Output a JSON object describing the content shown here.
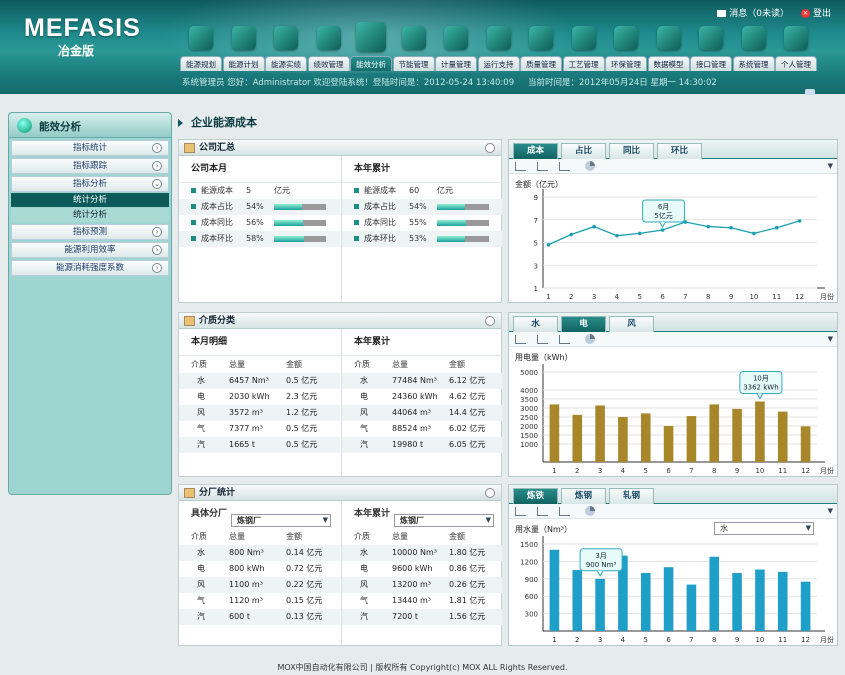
{
  "header": {
    "logo": "MEFASIS",
    "logo_sub": "冶金版",
    "messages": "消息（0未读）",
    "logout": "登出"
  },
  "nav": [
    "能源规划",
    "能源计划",
    "能源实绩",
    "绩效管理",
    "能效分析",
    "节能管理",
    "计量管理",
    "运行支持",
    "质量管理",
    "工艺管理",
    "环保管理",
    "数据模型",
    "接口管理",
    "系统管理",
    "个人管理"
  ],
  "status": {
    "user": "系统管理员    您好：Administrator 欢迎登陆系统！登陆时间是：2012-05-24 13:40:09",
    "time": "当前时间是：2012年05月24日 星期一   14:30:02"
  },
  "sidebar": {
    "title": "能效分析",
    "items": [
      {
        "label": "指标统计",
        "ch": "›"
      },
      {
        "label": "指标跟踪",
        "ch": "›"
      },
      {
        "label": "指标分析",
        "ch": "⌄"
      }
    ],
    "subs": [
      "统计分析",
      "统计分析"
    ],
    "items2": [
      {
        "label": "指标预测",
        "ch": "›"
      },
      {
        "label": "能源利用效率",
        "ch": "›"
      },
      {
        "label": "能源消耗强度系数",
        "ch": "›"
      }
    ]
  },
  "crumb": "企业能源成本",
  "p1": {
    "title": "公司汇总",
    "left_head": "公司本月",
    "right_head": "本年累计",
    "left": [
      {
        "k": "能源成本",
        "v": "5",
        "u": "亿元",
        "bar": null
      },
      {
        "k": "成本占比",
        "v": "54%",
        "bar": 0.54
      },
      {
        "k": "成本同比",
        "v": "56%",
        "bar": 0.56
      },
      {
        "k": "成本环比",
        "v": "58%",
        "bar": 0.58
      }
    ],
    "right": [
      {
        "k": "能源成本",
        "v": "60",
        "u": "亿元",
        "bar": null
      },
      {
        "k": "成本占比",
        "v": "54%",
        "bar": 0.54
      },
      {
        "k": "成本同比",
        "v": "55%",
        "bar": 0.55
      },
      {
        "k": "成本环比",
        "v": "53%",
        "bar": 0.53
      }
    ]
  },
  "p2": {
    "title": "介质分类",
    "left_head": "本月明细",
    "right_head": "本年累计",
    "cols": [
      "介质",
      "总量",
      "金额"
    ],
    "left": [
      [
        "水",
        "6457 Nm³",
        "0.5 亿元"
      ],
      [
        "电",
        "2030 kWh",
        "2.3 亿元"
      ],
      [
        "风",
        "3572 m³",
        "1.2 亿元"
      ],
      [
        "气",
        "7377 m³",
        "0.5 亿元"
      ],
      [
        "汽",
        "1665 t",
        "0.5 亿元"
      ]
    ],
    "right": [
      [
        "水",
        "77484 Nm³",
        "6.12 亿元"
      ],
      [
        "电",
        "24360 kWh",
        "4.62 亿元"
      ],
      [
        "风",
        "44064 m³",
        "14.4 亿元"
      ],
      [
        "气",
        "88524 m³",
        "6.02 亿元"
      ],
      [
        "汽",
        "19980 t",
        "6.05 亿元"
      ]
    ]
  },
  "p3": {
    "title": "分厂统计",
    "left_label": "具体分厂",
    "left_sel": "炼钢厂",
    "right_label": "本年累计",
    "right_sel": "炼钢厂",
    "cols": [
      "介质",
      "总量",
      "金额"
    ],
    "left": [
      [
        "水",
        "800 Nm³",
        "0.14 亿元"
      ],
      [
        "电",
        "800 kWh",
        "0.72 亿元"
      ],
      [
        "风",
        "1100 m³",
        "0.22 亿元"
      ],
      [
        "气",
        "1120 m³",
        "0.15 亿元"
      ],
      [
        "汽",
        "600 t",
        "0.13 亿元"
      ]
    ],
    "right": [
      [
        "水",
        "10000 Nm³",
        "1.80 亿元"
      ],
      [
        "电",
        "9600 kWh",
        "0.86 亿元"
      ],
      [
        "风",
        "13200 m³",
        "0.26 亿元"
      ],
      [
        "气",
        "13440 m³",
        "1.81 亿元"
      ],
      [
        "汽",
        "7200 t",
        "1.56 亿元"
      ]
    ]
  },
  "chart_tabs": [
    [
      "成本",
      "占比",
      "同比",
      "环比"
    ],
    [
      "水",
      "电",
      "风"
    ],
    [
      "炼铁",
      "炼钢",
      "轧钢"
    ]
  ],
  "chart3_select": "水",
  "chart_data": [
    {
      "type": "line",
      "title": "金额（亿元）",
      "ylabel": "金额（亿元）",
      "xlabel": "月份",
      "categories": [
        "1",
        "2",
        "3",
        "4",
        "5",
        "6",
        "7",
        "8",
        "9",
        "10",
        "11",
        "12"
      ],
      "values": [
        4.8,
        5.7,
        6.4,
        5.6,
        5.8,
        6.1,
        6.8,
        6.4,
        6.3,
        5.8,
        6.3,
        6.9
      ],
      "ylim": [
        1,
        9
      ],
      "yticks": [
        1,
        3,
        5,
        7,
        9
      ],
      "color": "#1aa0b0",
      "annotation": {
        "x": "6",
        "label": [
          "6月",
          "5亿元"
        ]
      }
    },
    {
      "type": "bar",
      "title": "用电量（kWh）",
      "ylabel": "用电量（kWh）",
      "xlabel": "月份",
      "categories": [
        "1",
        "2",
        "3",
        "4",
        "5",
        "6",
        "7",
        "8",
        "9",
        "10",
        "11",
        "12"
      ],
      "values": [
        3200,
        2620,
        3140,
        2500,
        2700,
        2000,
        2550,
        3200,
        2950,
        3362,
        2800,
        1980
      ],
      "ylim": [
        0,
        5000
      ],
      "yticks": [
        1000,
        1500,
        2000,
        2500,
        3000,
        3500,
        4000,
        5000
      ],
      "color": "#a8872a",
      "annotation": {
        "x": "10",
        "label": [
          "10月",
          "3362 kWh"
        ]
      }
    },
    {
      "type": "bar",
      "title": "用水量（Nm³）",
      "ylabel": "用水量（Nm³）",
      "xlabel": "月份",
      "categories": [
        "1",
        "2",
        "3",
        "4",
        "5",
        "6",
        "7",
        "8",
        "9",
        "10",
        "11",
        "12"
      ],
      "values": [
        1400,
        1050,
        900,
        1300,
        1000,
        1100,
        800,
        1280,
        1000,
        1060,
        1020,
        850
      ],
      "ylim": [
        0,
        1500
      ],
      "yticks": [
        300,
        600,
        900,
        1200,
        1500
      ],
      "color": "#1f9fc8",
      "annotation": {
        "x": "3",
        "label": [
          "3月",
          "900 Nm³"
        ]
      }
    }
  ],
  "footer": "MOX中国自动化有限公司  |  版权所有 Copyright(c) MOX ALL Rights Reserved."
}
